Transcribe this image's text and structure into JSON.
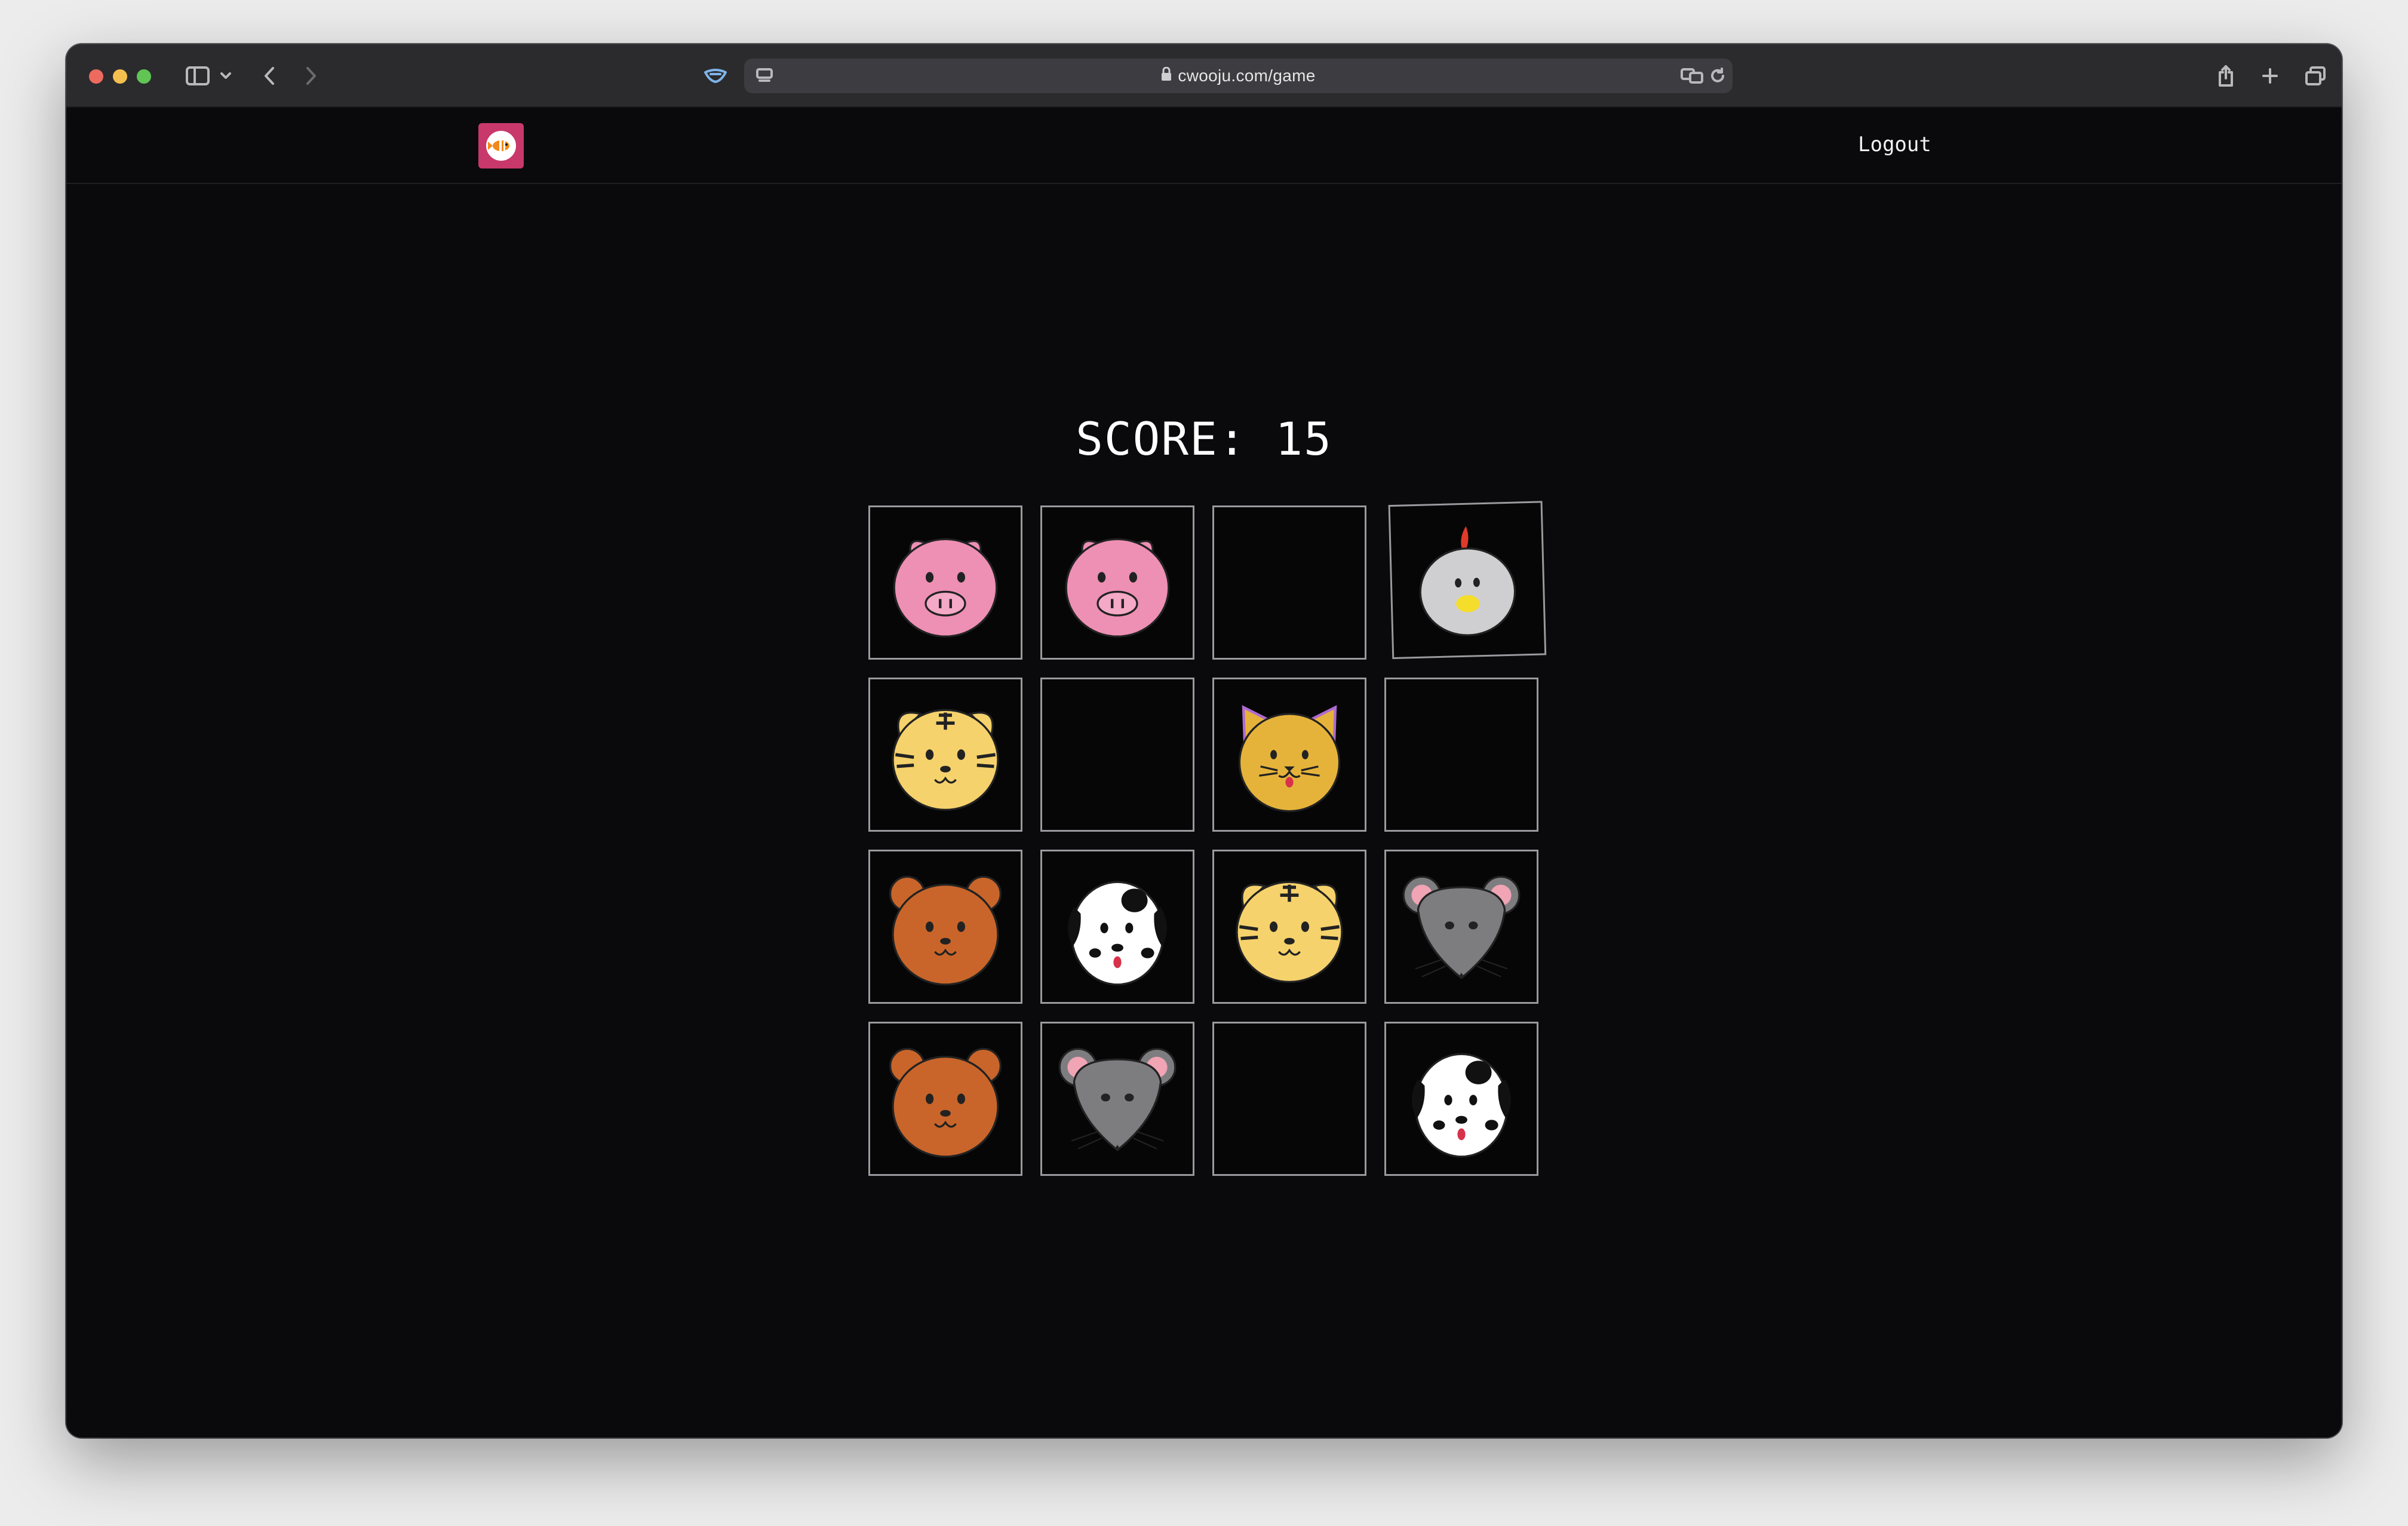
{
  "browser": {
    "url": "cwooju.com/game",
    "tabs_icon": "tab-overview-icon"
  },
  "header": {
    "logout_label": "Logout"
  },
  "game": {
    "score_text": "SCORE: 15",
    "cards": [
      {
        "animal": "pig",
        "face_up": true
      },
      {
        "animal": "pig",
        "face_up": true
      },
      {
        "animal": "",
        "face_up": false
      },
      {
        "animal": "chicken",
        "face_up": true
      },
      {
        "animal": "tiger",
        "face_up": true
      },
      {
        "animal": "",
        "face_up": false
      },
      {
        "animal": "cat",
        "face_up": true
      },
      {
        "animal": "",
        "face_up": false
      },
      {
        "animal": "bear",
        "face_up": true
      },
      {
        "animal": "dog",
        "face_up": true
      },
      {
        "animal": "tiger",
        "face_up": true
      },
      {
        "animal": "mouse",
        "face_up": true
      },
      {
        "animal": "bear",
        "face_up": true
      },
      {
        "animal": "mouse",
        "face_up": true
      },
      {
        "animal": "",
        "face_up": false
      },
      {
        "animal": "dog",
        "face_up": true
      }
    ]
  },
  "colors": {
    "page_bg": "#0a0a0c",
    "card_border": "#9a9a9e",
    "logo_bg": "#c9386a"
  }
}
